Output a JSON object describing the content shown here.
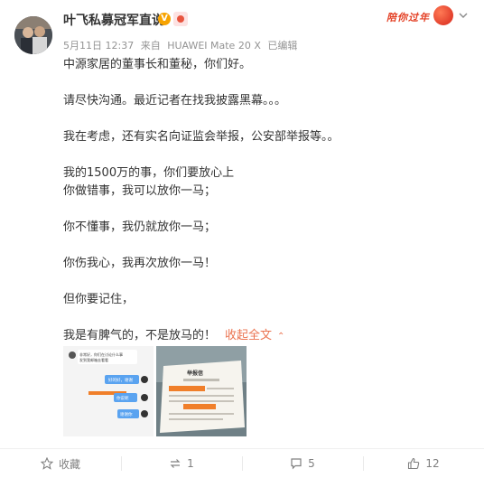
{
  "post": {
    "username": "叶飞私募冠军直说",
    "verified_badge": "V",
    "festive_label": "陪你过年",
    "meta": {
      "date": "5月11日 12:37",
      "source_prefix": "来自",
      "device": "HUAWEI Mate 20 X",
      "edited": "已编辑"
    },
    "paragraphs": [
      "中源家居的董事长和董秘，你们好。",
      "",
      "请尽快沟通。最近记者在找我披露黑幕。。。",
      "",
      "我在考虑，还有实名向证监会举报，公安部举报等。。",
      "",
      "我的1500万的事，你们要放心上",
      "你做错事，我可以放你一马；",
      "",
      "你不懂事，我仍就放你一马；",
      "",
      "你伤我心，我再次放你一马！",
      "",
      "但你要记住，",
      ""
    ],
    "last_line": "我是有脾气的，不是放马的！",
    "collapse_label": "收起全文",
    "image1_texts": {
      "line1": "非常好，你们在讨论什么事",
      "line2": "发到我邮箱去看看",
      "bubble1": "好的好，谢谢",
      "bubble2": "你说呢",
      "bubble3": "谢谢你"
    },
    "image2_title": "举报信"
  },
  "actions": {
    "favorite_label": "收藏",
    "repost_count": "1",
    "comment_count": "5",
    "like_count": "12"
  },
  "colors": {
    "link": "#eb7350",
    "meta": "#939393",
    "text": "#333333",
    "action": "#808080"
  }
}
